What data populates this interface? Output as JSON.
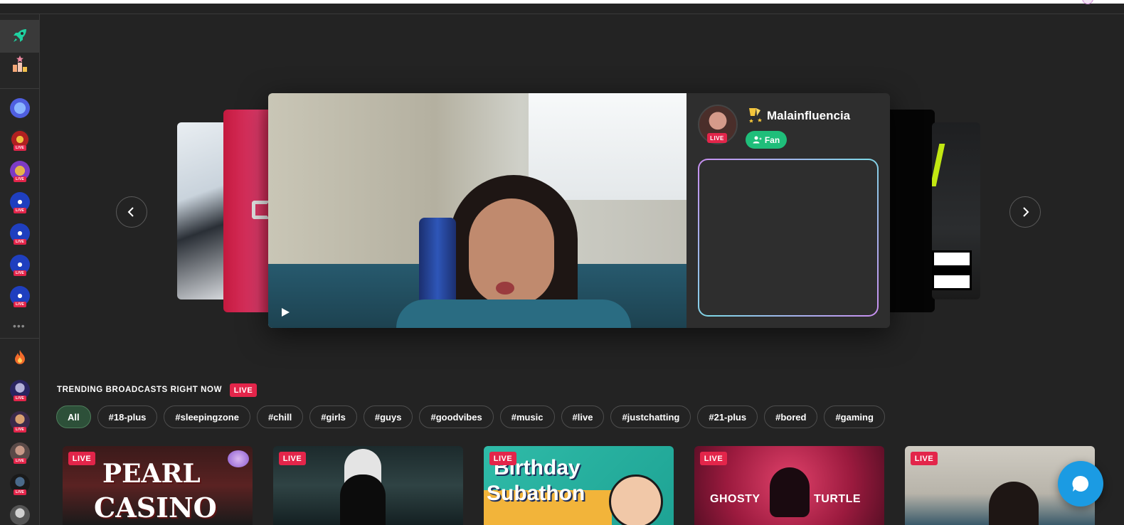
{
  "sidebar": {
    "live_label": "LIVE"
  },
  "featured": {
    "streamer_name": "Malainfluencia",
    "live_label": "LIVE",
    "fan_label": "Fan"
  },
  "trending": {
    "title": "TRENDING BROADCASTS RIGHT NOW",
    "live_label": "LIVE",
    "tags": [
      "All",
      "#18-plus",
      "#sleepingzone",
      "#chill",
      "#girls",
      "#guys",
      "#goodvibes",
      "#music",
      "#live",
      "#justchatting",
      "#21-plus",
      "#bored",
      "#gaming"
    ],
    "active_tag": "All"
  },
  "thumbnails": [
    {
      "live_label": "LIVE",
      "title_line1": "PEARL",
      "title_line2": "CASINO"
    },
    {
      "live_label": "LIVE"
    },
    {
      "live_label": "LIVE",
      "title_line1": "Birthday",
      "title_line2": "Subathon"
    },
    {
      "live_label": "LIVE",
      "title_left": "GHOSTY",
      "title_right": "TURTLE"
    },
    {
      "live_label": "LIVE"
    }
  ],
  "colors": {
    "accent_green": "#1fbe7a",
    "live_red": "#e3254a",
    "chat_blue": "#1b9be3",
    "background": "#232323"
  },
  "icons": [
    "rocket-icon",
    "leaderboard-icon",
    "dice-icon",
    "fire-icon",
    "play-icon",
    "chevron-left-icon",
    "chevron-right-icon",
    "chat-bubble-icon",
    "add-user-icon",
    "trophy-icon"
  ]
}
